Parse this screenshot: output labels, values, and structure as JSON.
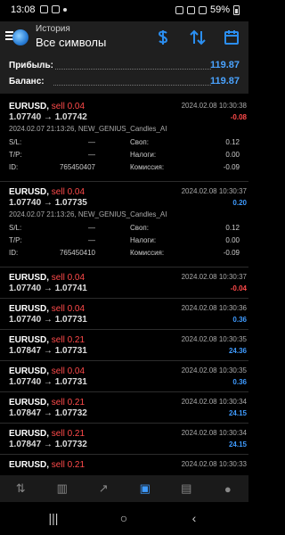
{
  "status_bar": {
    "time": "13:08",
    "battery": "59%",
    "left_icons": [
      "whatsapp-icon",
      "gallery-icon",
      "notification-dot-icon"
    ],
    "right_icons": [
      "alarm-icon",
      "wifi-icon",
      "signal-icon",
      "battery-icon"
    ]
  },
  "app_bar": {
    "subtitle": "История",
    "title": "Все символы",
    "icons": [
      "currency-icon",
      "sort-icon",
      "calendar-icon"
    ],
    "accent": "#2b8ef0"
  },
  "summary": {
    "profit_label": "Прибыль:",
    "profit_value": "119.87",
    "balance_label": "Баланс:",
    "balance_value": "119.87"
  },
  "trades": [
    {
      "symbol": "EURUSD,",
      "side": "sell 0.04",
      "prices": "1.07740 → 1.07742",
      "time": "2024.02.08 10:30:38",
      "profit": "-0.08",
      "profit_sign": "neg",
      "expanded": true,
      "comment": "2024.02.07 21:13:26, NEW_GENIUS_Candles_AI",
      "sl_label": "S/L:",
      "sl_value": "—",
      "tp_label": "T/P:",
      "tp_value": "—",
      "id_label": "ID:",
      "id_value": "765450407",
      "swap_label": "Своп:",
      "swap_value": "0.12",
      "tax_label": "Налоги:",
      "tax_value": "0.00",
      "commission_label": "Комиссия:",
      "commission_value": "-0.09"
    },
    {
      "symbol": "EURUSD,",
      "side": "sell 0.04",
      "prices": "1.07740 → 1.07735",
      "time": "2024.02.08 10:30:37",
      "profit": "0.20",
      "profit_sign": "pos",
      "expanded": true,
      "comment": "2024.02.07 21:13:26, NEW_GENIUS_Candles_AI",
      "sl_label": "S/L:",
      "sl_value": "—",
      "tp_label": "T/P:",
      "tp_value": "—",
      "id_label": "ID:",
      "id_value": "765450410",
      "swap_label": "Своп:",
      "swap_value": "0.12",
      "tax_label": "Налоги:",
      "tax_value": "0.00",
      "commission_label": "Комиссия:",
      "commission_value": "-0.09"
    },
    {
      "symbol": "EURUSD,",
      "side": "sell 0.04",
      "prices": "1.07740 → 1.07741",
      "time": "2024.02.08 10:30:37",
      "profit": "-0.04",
      "profit_sign": "neg",
      "expanded": false
    },
    {
      "symbol": "EURUSD,",
      "side": "sell 0.04",
      "prices": "1.07740 → 1.07731",
      "time": "2024.02.08 10:30:36",
      "profit": "0.36",
      "profit_sign": "pos",
      "expanded": false
    },
    {
      "symbol": "EURUSD,",
      "side": "sell 0.21",
      "prices": "1.07847 → 1.07731",
      "time": "2024.02.08 10:30:35",
      "profit": "24.36",
      "profit_sign": "pos",
      "expanded": false
    },
    {
      "symbol": "EURUSD,",
      "side": "sell 0.04",
      "prices": "1.07740 → 1.07731",
      "time": "2024.02.08 10:30:35",
      "profit": "0.36",
      "profit_sign": "pos",
      "expanded": false
    },
    {
      "symbol": "EURUSD,",
      "side": "sell 0.21",
      "prices": "1.07847 → 1.07732",
      "time": "2024.02.08 10:30:34",
      "profit": "24.15",
      "profit_sign": "pos",
      "expanded": false
    },
    {
      "symbol": "EURUSD,",
      "side": "sell 0.21",
      "prices": "1.07847 → 1.07732",
      "time": "2024.02.08 10:30:34",
      "profit": "24.15",
      "profit_sign": "pos",
      "expanded": false
    },
    {
      "symbol": "EURUSD,",
      "side": "sell 0.21",
      "prices": "",
      "time": "2024.02.08 10:30:33",
      "profit": "",
      "profit_sign": "pos",
      "expanded": false
    }
  ],
  "tab_bar": {
    "active": 4,
    "tabs": [
      {
        "icon": "quotes-icon",
        "glyph": "⇅"
      },
      {
        "icon": "chart-candles-icon",
        "glyph": "▥"
      },
      {
        "icon": "trade-chart-icon",
        "glyph": "↗"
      },
      {
        "icon": "history-inbox-icon",
        "glyph": "▣"
      },
      {
        "icon": "news-icon",
        "glyph": "▤"
      },
      {
        "icon": "messages-icon",
        "glyph": "●"
      }
    ]
  },
  "nav_bar": {
    "buttons": [
      {
        "icon": "recent-apps-icon",
        "glyph": "|||"
      },
      {
        "icon": "home-icon",
        "glyph": "○"
      },
      {
        "icon": "back-icon",
        "glyph": "‹"
      }
    ]
  }
}
